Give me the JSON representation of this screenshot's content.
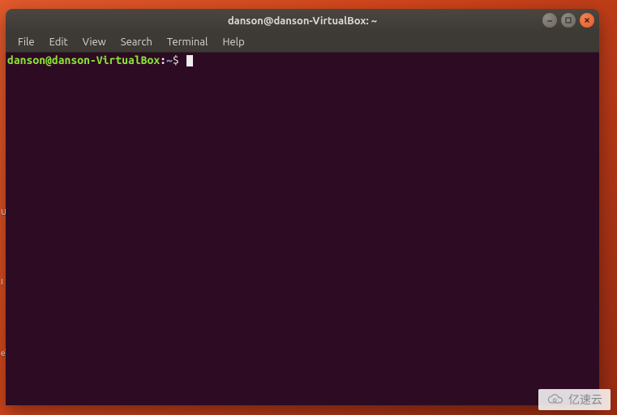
{
  "window": {
    "title": "danson@danson-VirtualBox: ~"
  },
  "menubar": {
    "items": [
      "File",
      "Edit",
      "View",
      "Search",
      "Terminal",
      "Help"
    ]
  },
  "prompt": {
    "user_host": "danson@danson-VirtualBox",
    "separator": ":",
    "path": "~",
    "symbol": "$"
  },
  "launcher": {
    "labels": [
      "U",
      "I",
      "e\\"
    ]
  },
  "watermark": {
    "text": "亿速云"
  }
}
